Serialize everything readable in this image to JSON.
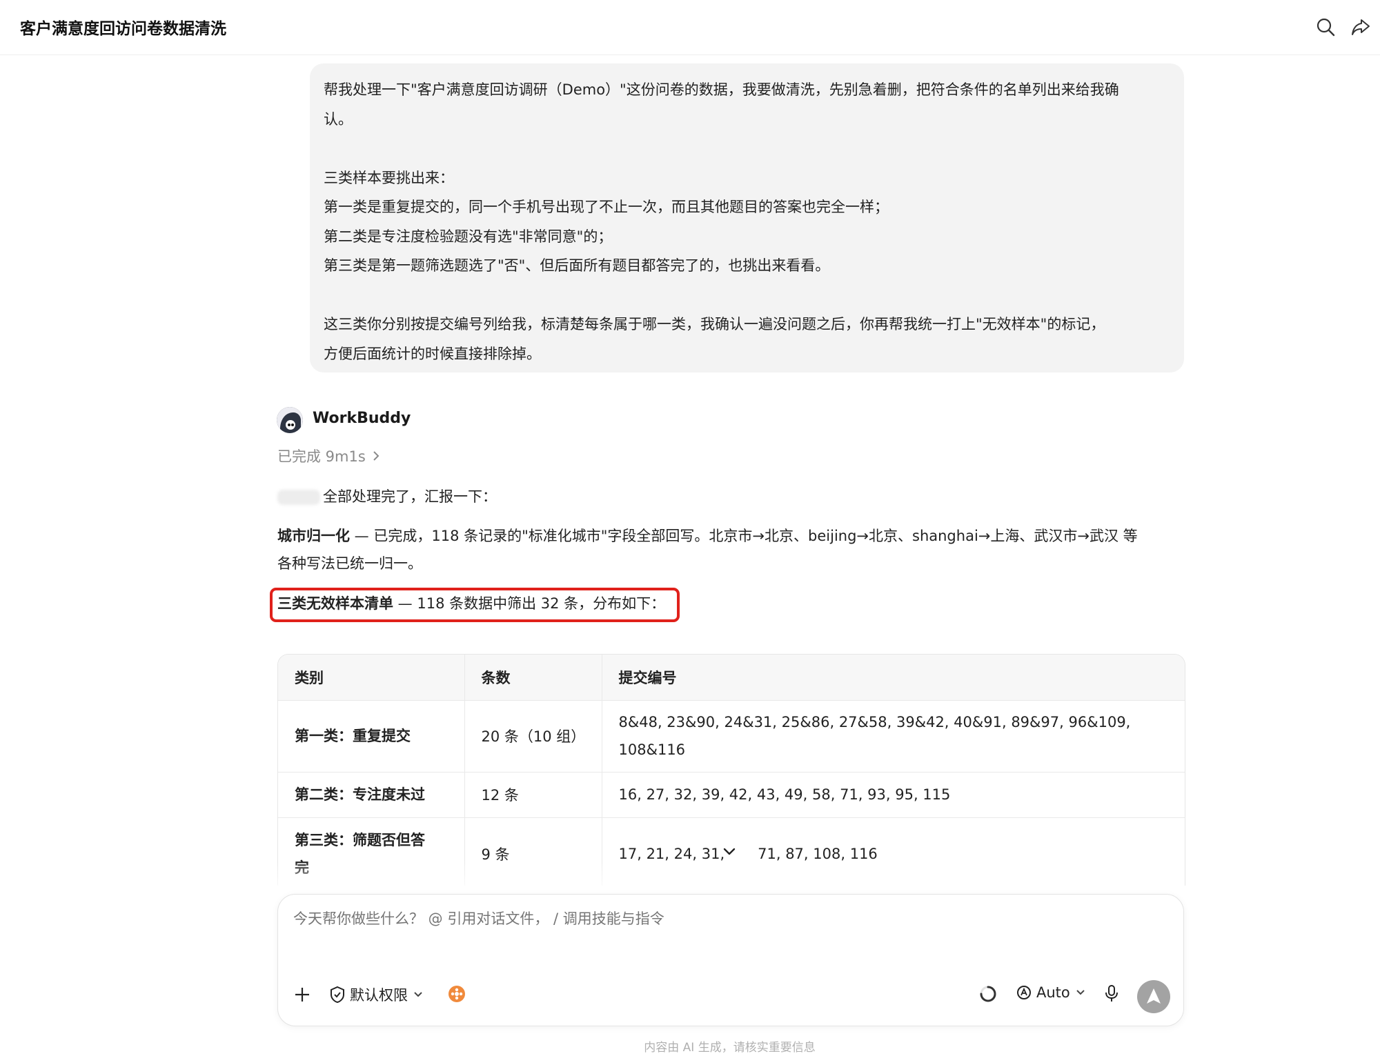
{
  "header": {
    "title": "客户满意度回访问卷数据清洗",
    "icons": [
      "search-icon",
      "share-icon"
    ]
  },
  "user_message": {
    "lines": [
      "帮我处理一下\"客户满意度回访调研（Demo）\"这份问卷的数据，我要做清洗，先别急着删，把符合条件的名单列出来给我确",
      "认。",
      "",
      "三类样本要挑出来：",
      "第一类是重复提交的，同一个手机号出现了不止一次，而且其他题目的答案也完全一样；",
      "第二类是专注度检验题没有选\"非常同意\"的；",
      "第三类是第一题筛选题选了\"否\"、但后面所有题目都答完了的，也挑出来看看。",
      "",
      "这三类你分别按提交编号列给我，标清楚每条属于哪一类，我确认一遍没问题之后，你再帮我统一打上\"无效样本\"的标记，",
      "方便后面统计的时候直接排除掉。"
    ]
  },
  "assistant": {
    "name": "WorkBuddy",
    "status": "已完成 9m1s",
    "intro": "全部处理完了，汇报一下：",
    "city_title": "城市归一化",
    "city_text": " — 已完成，118 条记录的\"标准化城市\"字段全部回写。北京市→北京、beijing→北京、shanghai→上海、武汉市→武汉 等",
    "city_text2": "各种写法已统一归一。",
    "invalid_title": "三类无效样本清单",
    "invalid_text": " — 118 条数据中筛出 32 条，分布如下："
  },
  "table": {
    "headers": [
      "类别",
      "条数",
      "提交编号"
    ],
    "rows": [
      {
        "category": "第一类：重复提交",
        "count": "20 条（10 组）",
        "ids": "8&48, 23&90, 24&31, 25&86, 27&58, 39&42, 40&91, 89&97, 96&109,",
        "ids2": "108&116"
      },
      {
        "category": "第二类：专注度未过",
        "count": "12 条",
        "ids": "16, 27, 32, 39, 42, 43, 49, 58, 71, 93, 95, 115",
        "ids2": ""
      },
      {
        "category": "第三类：筛题否但答",
        "category2": "完",
        "count": "9 条",
        "ids": "17, 21, 24, 31,",
        "ids_b": "71, 87, 108, 116",
        "ids2": ""
      }
    ]
  },
  "composer": {
    "placeholder": "今天帮你做些什么？ @ 引用对话文件， / 调用技能与指令",
    "permission_label": "默认权限",
    "model_label": "Auto"
  },
  "footer": {
    "note": "内容由 AI 生成，请核实重要信息"
  },
  "colors": {
    "highlight": "#e0211b",
    "bubble_bg": "#f3f3f3",
    "send_button": "#a3a3a3",
    "skill_badge": "#f08a3c"
  }
}
